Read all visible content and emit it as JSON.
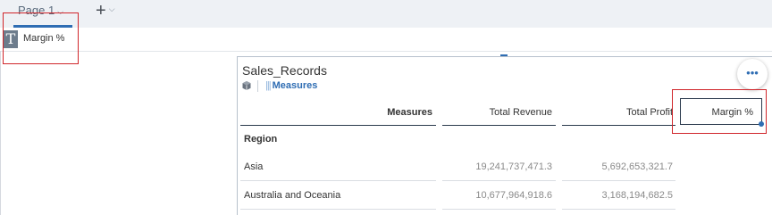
{
  "tabs": {
    "page_tab_label": "Page 1",
    "page_tab_chevron": "⌵",
    "add_page_symbol": "+",
    "add_page_chevron": "⌵"
  },
  "title_widget": {
    "icon_glyph": "T",
    "label": "Margin %"
  },
  "table_widget": {
    "title": "Sales_Records",
    "measures_link_bars": "|||",
    "measures_link": "Measures",
    "more_button": "•••",
    "header": {
      "measures": "Measures",
      "total_revenue": "Total Revenue",
      "total_profit": "Total Profit",
      "margin_pct": "Margin %"
    },
    "dimension_label": "Region",
    "rows": [
      {
        "region": "Asia",
        "total_revenue": "19,241,737,471.3",
        "total_profit": "5,692,653,321.7"
      },
      {
        "region": "Australia and Oceania",
        "total_revenue": "10,677,964,918.6",
        "total_profit": "3,168,194,682.5"
      }
    ]
  },
  "colors": {
    "accent": "#2f6db3",
    "highlight_box": "#d0262b",
    "tab_bar_bg": "#eef1f5"
  }
}
